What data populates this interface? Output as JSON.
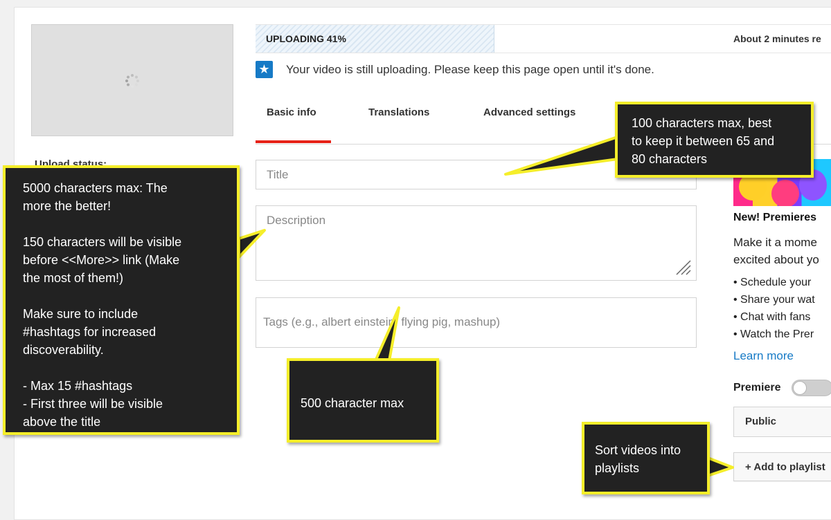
{
  "upload": {
    "status_label": "Upload status:",
    "progress_text": "UPLOADING 41%",
    "progress_percent": 41,
    "time_remaining": "About 2 minutes re",
    "notice": "Your video is still uploading. Please keep this page open until it's done."
  },
  "tabs": [
    {
      "label": "Basic info",
      "active": true
    },
    {
      "label": "Translations",
      "active": false
    },
    {
      "label": "Advanced settings",
      "active": false
    }
  ],
  "form": {
    "title_placeholder": "Title",
    "description_placeholder": "Description",
    "tags_placeholder": "Tags (e.g., albert einstein, flying pig, mashup)"
  },
  "sidebar": {
    "promo_title": "New! Premieres",
    "promo_text": [
      "Make it a mome",
      "excited about yo"
    ],
    "promo_list": [
      "• Schedule your",
      "• Share your wat",
      "• Chat with fans",
      "• Watch the Prer"
    ],
    "learn_more": "Learn more",
    "premiere_label": "Premiere",
    "premiere_enabled": false,
    "visibility": "Public",
    "add_playlist": "+ Add to playlist"
  },
  "callouts": {
    "description": "5000 characters max: The\nmore the better!\n\n150 characters will be visible\nbefore <<More>> link (Make\nthe most of them!)\n\nMake sure to include\n#hashtags for increased\ndiscoverability.\n\n- Max 15 #hashtags\n- First three will be visible\nabove the title",
    "title": "100 characters max, best\nto keep it between 65 and\n80 characters",
    "tags": "500 character max",
    "playlist": "Sort videos into\nplaylists"
  },
  "colors": {
    "accent_blue": "#167ac6",
    "tab_indicator": "#e62117",
    "callout_border": "#f5ee2a",
    "callout_bg": "#222222"
  }
}
